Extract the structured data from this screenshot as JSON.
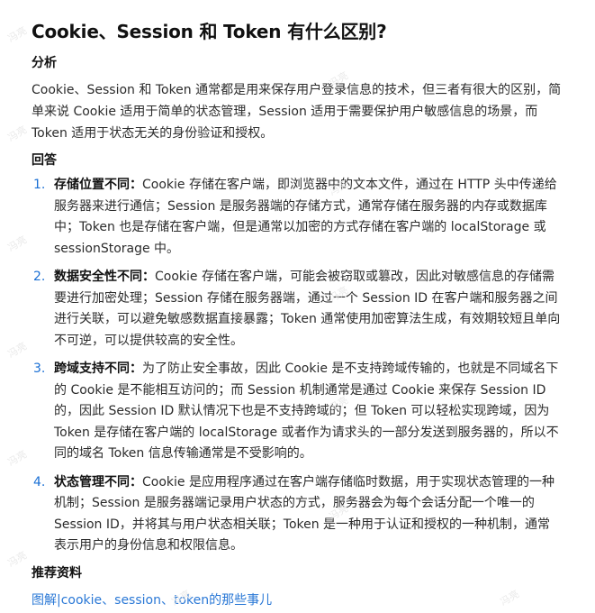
{
  "title": "Cookie、Session 和 Token 有什么区别?",
  "analysis": {
    "heading": "分析",
    "text": "Cookie、Session 和 Token 通常都是用来保存用户登录信息的技术，但三者有很大的区别，简单来说 Cookie 适用于简单的状态管理，Session 适用于需要保护用户敏感信息的场景，而 Token 适用于状态无关的身份验证和授权。"
  },
  "answer": {
    "heading": "回答",
    "items": [
      {
        "num": "1.",
        "label": "存储位置不同：",
        "text": "Cookie 存储在客户端，即浏览器中的文本文件，通过在 HTTP 头中传递给服务器来进行通信；Session 是服务器端的存储方式，通常存储在服务器的内存或数据库中；Token 也是存储在客户端，但是通常以加密的方式存储在客户端的 localStorage 或 sessionStorage 中。"
      },
      {
        "num": "2.",
        "label": "数据安全性不同：",
        "text": "Cookie 存储在客户端，可能会被窃取或篡改，因此对敏感信息的存储需要进行加密处理；Session 存储在服务器端，通过一个 Session ID 在客户端和服务器之间进行关联，可以避免敏感数据直接暴露；Token 通常使用加密算法生成，有效期较短且单向不可逆，可以提供较高的安全性。"
      },
      {
        "num": "3.",
        "label": "跨域支持不同：",
        "text": "为了防止安全事故，因此 Cookie 是不支持跨域传输的，也就是不同域名下的 Cookie 是不能相互访问的；而 Session 机制通常是通过 Cookie 来保存 Session ID 的，因此 Session ID 默认情况下也是不支持跨域的；但 Token 可以轻松实现跨域，因为 Token 是存储在客户端的 localStorage 或者作为请求头的一部分发送到服务器的，所以不同的域名 Token 信息传输通常是不受影响的。"
      },
      {
        "num": "4.",
        "label": "状态管理不同：",
        "text": "Cookie 是应用程序通过在客户端存储临时数据，用于实现状态管理的一种机制；Session 是服务器端记录用户状态的方式，服务器会为每个会话分配一个唯一的 Session ID，并将其与用户状态相关联；Token 是一种用于认证和授权的一种机制，通常表示用户的身份信息和权限信息。"
      }
    ]
  },
  "references": {
    "heading": "推荐资料",
    "link_text": "图解|cookie、session、token的那些事儿"
  },
  "watermark_text": "冯亮"
}
